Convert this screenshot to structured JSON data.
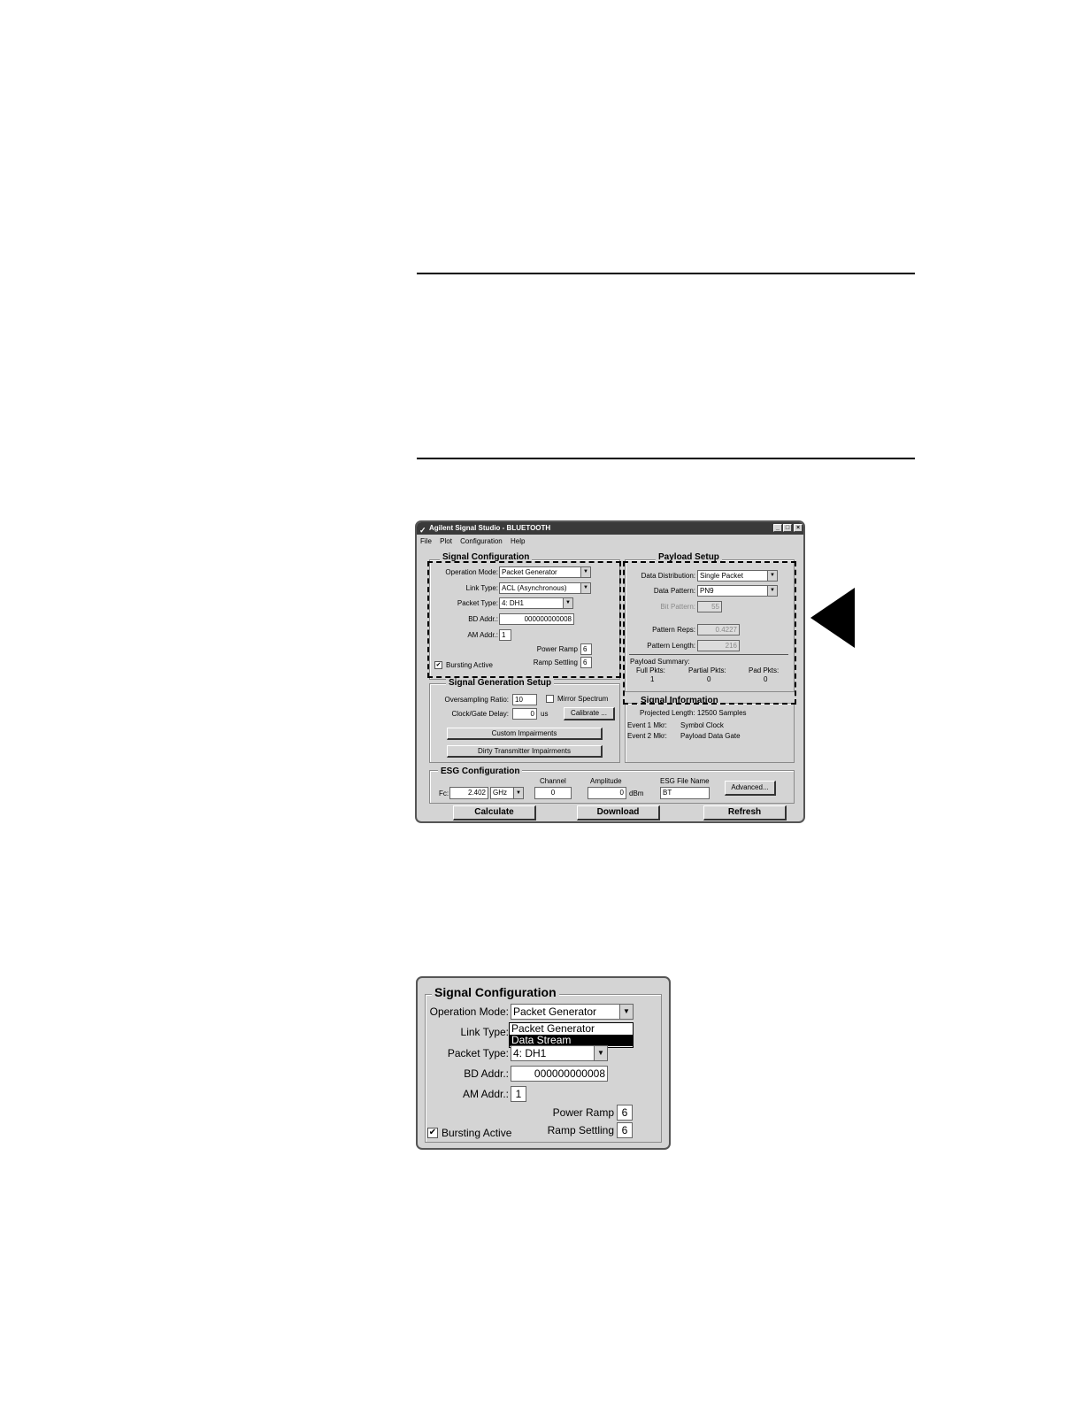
{
  "main_window": {
    "title": "Agilent Signal Studio - BLUETOOTH",
    "controls": {
      "minimize": "_",
      "maximize": "□",
      "close": "×"
    },
    "menu": [
      "File",
      "Plot",
      "Configuration",
      "Help"
    ],
    "signal_config": {
      "title": "Signal Configuration",
      "operation_mode_label": "Operation Mode:",
      "operation_mode_value": "Packet Generator",
      "link_type_label": "Link Type:",
      "link_type_value": "ACL (Asynchronous)",
      "packet_type_label": "Packet Type:",
      "packet_type_value": "4: DH1",
      "bd_addr_label": "BD Addr.:",
      "bd_addr_value": "000000000008",
      "am_addr_label": "AM Addr.:",
      "am_addr_value": "1",
      "power_ramp_label": "Power Ramp",
      "power_ramp_value": "6",
      "ramp_settling_label": "Ramp Settling",
      "ramp_settling_value": "6",
      "bursting_active_label": "Bursting Active",
      "bursting_active_checked": true
    },
    "sig_gen_setup": {
      "title": "Signal Generation Setup",
      "oversampling_label": "Oversampling Ratio:",
      "oversampling_value": "10",
      "mirror_spectrum_label": "Mirror Spectrum",
      "mirror_spectrum_checked": false,
      "clock_gate_delay_label": "Clock/Gate Delay:",
      "clock_gate_delay_value": "0",
      "clock_gate_delay_unit": "us",
      "calibrate_button": "Calibrate ...",
      "custom_impairments_button": "Custom Impairments",
      "dirty_transmitter_button": "Dirty Transmitter Impairments"
    },
    "payload_setup": {
      "title": "Payload Setup",
      "data_distribution_label": "Data Distribution:",
      "data_distribution_value": "Single Packet",
      "data_pattern_label": "Data Pattern:",
      "data_pattern_value": "PN9",
      "bit_pattern_label": "Bit Pattern:",
      "bit_pattern_value": "55",
      "pattern_reps_label": "Pattern Reps:",
      "pattern_reps_value": "0.4227",
      "pattern_length_label": "Pattern Length:",
      "pattern_length_value": "216",
      "summary_label": "Payload Summary:",
      "full_pkts_label": "Full Pkts:",
      "full_pkts_value": "1",
      "partial_pkts_label": "Partial Pkts:",
      "partial_pkts_value": "0",
      "pad_pkts_label": "Pad Pkts:",
      "pad_pkts_value": "0"
    },
    "signal_info": {
      "title": "Signal Information",
      "projected_length": "Projected Length: 12500 Samples",
      "event1_label": "Event 1 Mkr:",
      "event1_value": "Symbol Clock",
      "event2_label": "Event 2 Mkr:",
      "event2_value": "Payload Data Gate"
    },
    "esg_config": {
      "title": "ESG Configuration",
      "fc_label": "Fc:",
      "fc_value": "2.402",
      "fc_unit": "GHz",
      "channel_label": "Channel",
      "channel_value": "0",
      "amplitude_label": "Amplitude",
      "amplitude_value": "0",
      "amplitude_unit": "dBm",
      "file_name_label": "ESG File Name",
      "file_name_value": "BT",
      "advanced_button": "Advanced..."
    },
    "buttons": {
      "calculate": "Calculate",
      "download": "Download",
      "refresh": "Refresh"
    }
  },
  "zoom_window": {
    "title": "Signal Configuration",
    "operation_mode_label": "Operation Mode:",
    "operation_mode_value": "Packet Generator",
    "dropdown_options": [
      "Packet Generator",
      "Data Stream"
    ],
    "dropdown_selected_index": 1,
    "link_type_label": "Link Type:",
    "packet_type_label": "Packet Type:",
    "packet_type_value": "4: DH1",
    "bd_addr_label": "BD Addr.:",
    "bd_addr_value": "000000000008",
    "am_addr_label": "AM Addr.:",
    "am_addr_value": "1",
    "power_ramp_label": "Power Ramp",
    "power_ramp_value": "6",
    "ramp_settling_label": "Ramp Settling",
    "ramp_settling_value": "6",
    "bursting_active_label": "Bursting Active",
    "bursting_active_checked": true
  }
}
